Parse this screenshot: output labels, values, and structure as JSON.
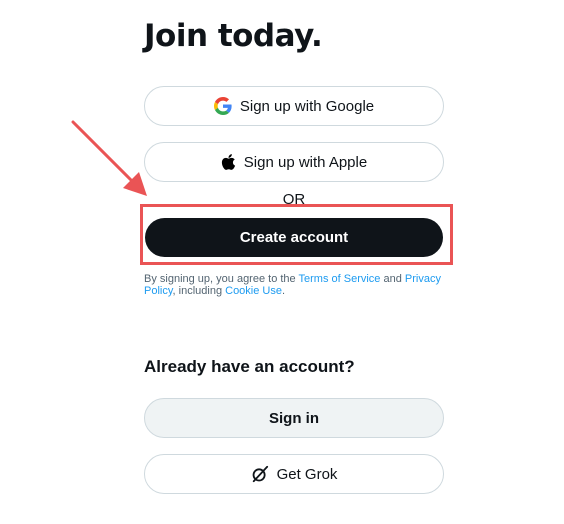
{
  "heading": "Join today.",
  "google_button": {
    "label": "Sign up with Google",
    "icon": "google-icon"
  },
  "apple_button": {
    "label": "Sign up with Apple",
    "icon": "apple-icon"
  },
  "divider": "OR",
  "create_button": {
    "label": "Create account"
  },
  "terms": {
    "prefix": "By signing up, you agree to the ",
    "tos_link": "Terms of Service",
    "and": " and ",
    "privacy_link": "Privacy Policy",
    "including": ", including ",
    "cookie_link": "Cookie Use",
    "suffix": "."
  },
  "signin_section": {
    "heading": "Already have an account?",
    "signin_label": "Sign in",
    "grok_label": "Get Grok",
    "grok_icon": "grok-icon"
  },
  "annotation": {
    "color": "#ea5455"
  },
  "colors": {
    "primary": "#0f1419",
    "link": "#1d9bf0",
    "muted": "#536471",
    "border": "#cfd9de"
  }
}
